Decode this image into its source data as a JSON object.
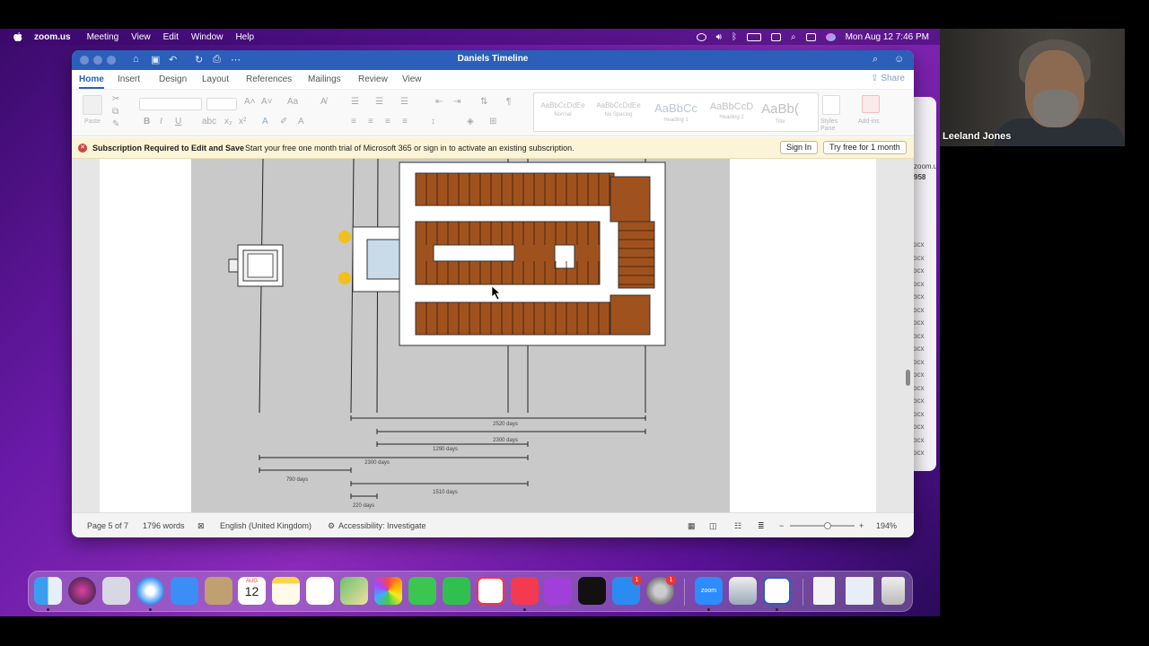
{
  "menubar": {
    "app_name": "zoom.us",
    "menus": [
      "Meeting",
      "View",
      "Edit",
      "Window",
      "Help"
    ],
    "clock": "Mon Aug 12  7:46 PM"
  },
  "video": {
    "participant_name": "Leeland Jones"
  },
  "zoom_window": {
    "url_fragment": "zoom.us/",
    "url_number": "958",
    "file_suffix": "ocx"
  },
  "word": {
    "doc_title": "Daniels Timeline",
    "tabs": [
      "Home",
      "Insert",
      "Design",
      "Layout",
      "References",
      "Mailings",
      "Review",
      "View"
    ],
    "share_label": "Share",
    "ribbon": {
      "paste_label": "Paste",
      "styles": [
        {
          "sample": "AaBbCcDdEe",
          "name": "Normal"
        },
        {
          "sample": "AaBbCcDdEe",
          "name": "No Spacing"
        },
        {
          "sample": "AaBbCc",
          "name": "Heading 1"
        },
        {
          "sample": "AaBbCcD",
          "name": "Heading 2"
        },
        {
          "sample": "AaBb(",
          "name": "Title"
        }
      ],
      "styles_pane_label": "Styles\nPane",
      "addins_label": "Add-ins"
    },
    "notice": {
      "title": "Subscription Required to Edit and Save",
      "message": "Start your free one month trial of Microsoft 365 or sign in to activate an existing subscription.",
      "signin_label": "Sign In",
      "trial_label": "Try free for 1 month"
    },
    "drawing": {
      "timeline_labels": [
        "2520 days",
        "2300 days",
        "1290 days",
        "2300 days",
        "790 days",
        "1510 days",
        "220 days"
      ]
    },
    "status": {
      "page": "Page 5 of 7",
      "words": "1796 words",
      "language": "English (United Kingdom)",
      "accessibility": "Accessibility: Investigate",
      "zoom": "194%"
    }
  },
  "dock": {
    "calendar_month": "AUG",
    "calendar_day": "12",
    "badge_app_store": "1",
    "badge_settings": "1",
    "zoom_label": "zoom"
  },
  "colors": {
    "word_blue": "#2b5fb9",
    "wood": "#a0521e",
    "notice_bg": "#fcf4d6"
  }
}
